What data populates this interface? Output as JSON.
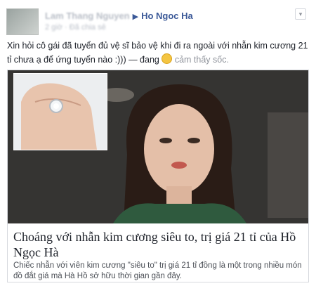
{
  "post": {
    "author": "Lam Thang Nguyen",
    "arrow": "▶",
    "target": "Ho Ngoc Ha",
    "meta": "2 giờ · Đã chia sẻ",
    "chevron": "▾",
    "status_text": "Xin hỏi cô gái đã tuyển đủ vệ sĩ bảo vệ khi đi ra ngoài với nhẫn kim cương 21 tỉ chưa ạ để ứng tuyển nào :))) — đang ",
    "feeling_text": " cảm thấy sốc."
  },
  "link_card": {
    "headline": "Choáng với nhẫn kim cương siêu to, trị giá 21 tỉ của Hồ Ngọc Hà",
    "description": "Chiếc nhẫn với viên kim cương \"siêu to\" trị giá 21 tỉ đồng là một trong nhiều món đồ đắt giá mà Hà Hồ sở hữu thời gian gần đây."
  },
  "colors": {
    "link_blue": "#3b5998",
    "text": "#1d2129",
    "muted": "#90949c",
    "border": "#d7d9de"
  },
  "icons": [
    "chevron-down-icon",
    "feeling-emoji-icon"
  ]
}
